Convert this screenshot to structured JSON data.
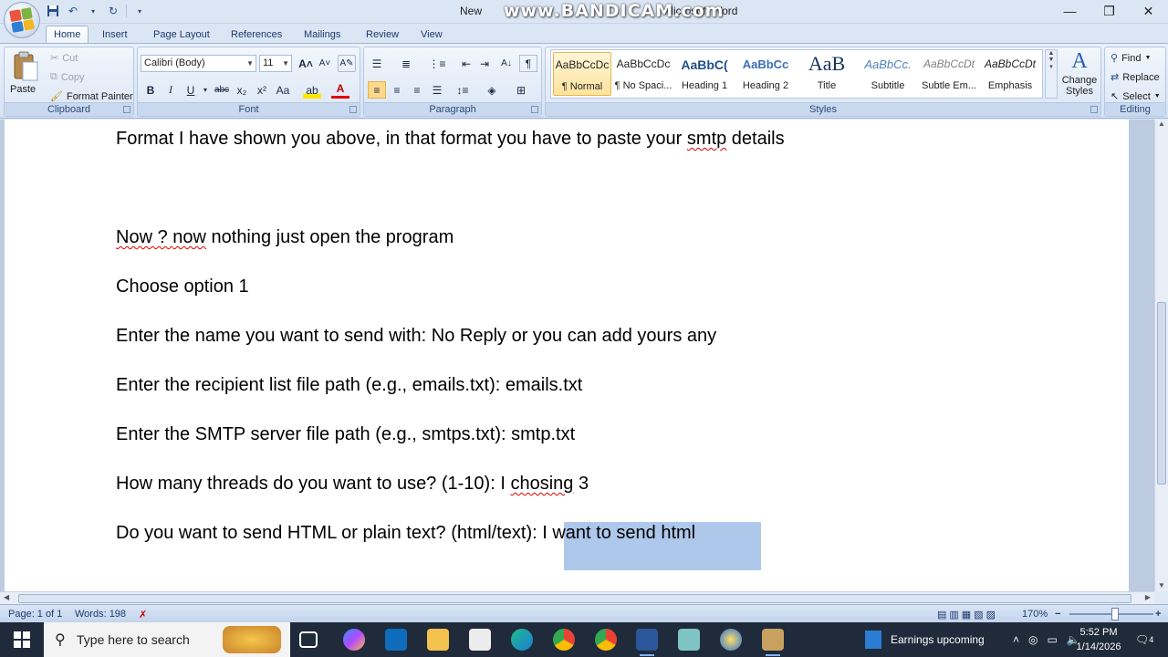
{
  "window": {
    "title_left": "New",
    "title_right": "Microsoft Word",
    "overlay": "www.BANDICAM.com",
    "controls": {
      "minimize": "—",
      "maximize": "❐",
      "close": "✕"
    }
  },
  "tabs": [
    "Home",
    "Insert",
    "Page Layout",
    "References",
    "Mailings",
    "Review",
    "View"
  ],
  "clipboard": {
    "paste": "Paste",
    "cut": "Cut",
    "copy": "Copy",
    "format_painter": "Format Painter",
    "label": "Clipboard"
  },
  "font": {
    "name": "Calibri (Body)",
    "size": "11",
    "label": "Font",
    "bold": "B",
    "italic": "I",
    "underline": "U",
    "strike": "abc",
    "sub": "x₂",
    "sup": "x²",
    "case": "Aa",
    "grow": "A˄",
    "shrink": "A˅"
  },
  "paragraph": {
    "label": "Paragraph"
  },
  "styles": {
    "label": "Styles",
    "items": [
      {
        "sample": "AaBbCcDc",
        "name": "¶ Normal"
      },
      {
        "sample": "AaBbCcDc",
        "name": "¶ No Spaci..."
      },
      {
        "sample": "AaBbC(",
        "name": "Heading 1"
      },
      {
        "sample": "AaBbCc",
        "name": "Heading 2"
      },
      {
        "sample": "AaB",
        "name": "Title"
      },
      {
        "sample": "AaBbCc.",
        "name": "Subtitle"
      },
      {
        "sample": "AaBbCcDt",
        "name": "Subtle Em..."
      },
      {
        "sample": "AaBbCcDt",
        "name": "Emphasis"
      }
    ],
    "change_styles": "Change Styles"
  },
  "editing": {
    "find": "Find",
    "replace": "Replace",
    "select": "Select",
    "label": "Editing"
  },
  "document": {
    "line1_a": "Format I have shown you above, in that format you have to paste your ",
    "line1_b": "smtp",
    "line1_c": " details",
    "line2_a": "Now ? ",
    "line2_b": "now",
    "line2_c": " nothing just open the program",
    "line3": "Choose option 1",
    "line4": "Enter the name you want to send with: No Reply or you can add yours any",
    "line5": "Enter the recipient list file path (e.g., emails.txt): emails.txt",
    "line6": "Enter the SMTP server file path (e.g., smtps.txt): smtp.txt",
    "line7_a": "How many threads do you want to use? (1-10): I ",
    "line7_b": "chosing",
    "line7_c": " 3",
    "line8_a": "Do you want to send HTML or plain text? (html/text)",
    "line8_b": ": I want to send html"
  },
  "status": {
    "page": "Page: 1 of 1",
    "words": "Words: 198",
    "zoom": "170%",
    "zoom_out": "−",
    "zoom_in": "+"
  },
  "taskbar": {
    "search_placeholder": "Type here to search",
    "news": "Earnings upcoming",
    "time": "5:52 PM",
    "date": "1/14/2026",
    "notifications": "4"
  },
  "colors": {
    "selection": "#aec8ec",
    "ribbon": "#dbe6f4",
    "taskbar": "#1f2a3a",
    "spell": "#d00000"
  }
}
